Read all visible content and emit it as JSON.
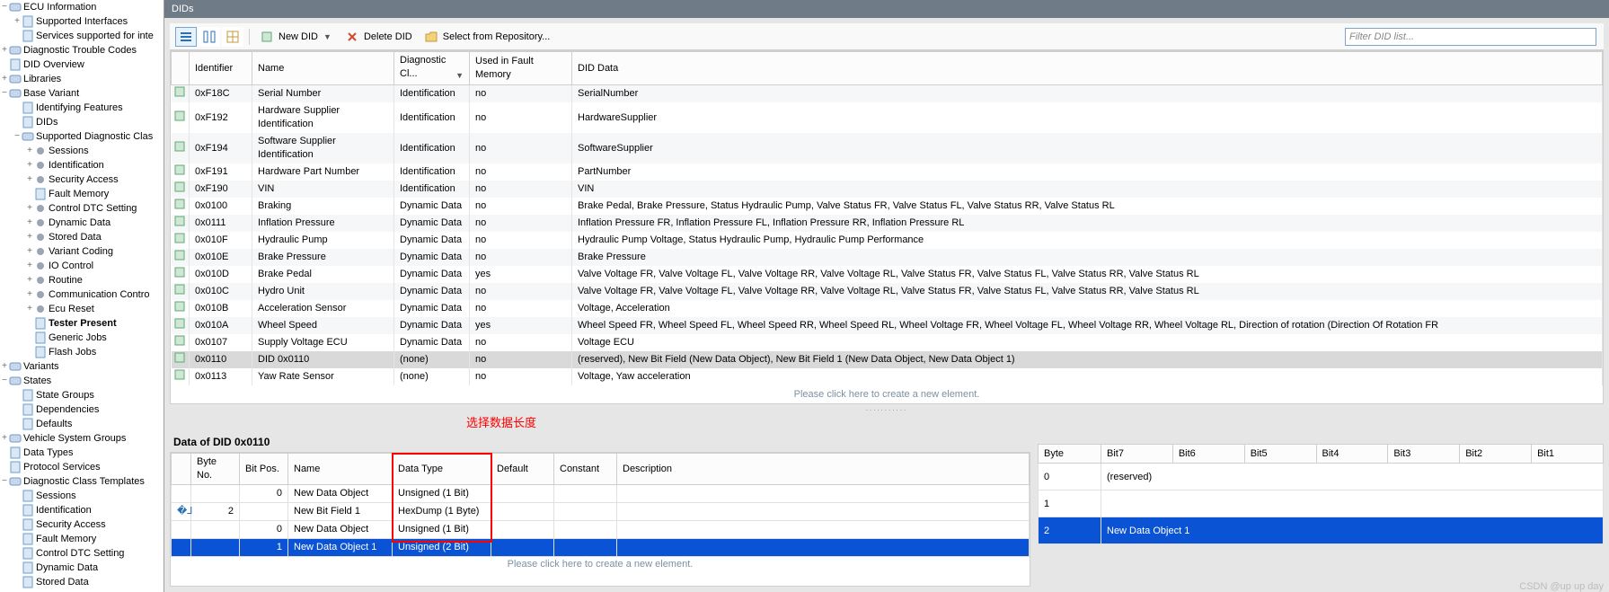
{
  "title_strip": "DIDs",
  "toolbar": {
    "new_did": "New DID",
    "delete_did": "Delete DID",
    "select_repo": "Select from Repository...",
    "filter_placeholder": "Filter DID list..."
  },
  "red_annotation": "选择数据长度",
  "tree": [
    {
      "ind": 0,
      "tw": "−",
      "ico": "db",
      "label": "ECU Information"
    },
    {
      "ind": 1,
      "tw": "+",
      "ico": "doc",
      "label": "Supported Interfaces"
    },
    {
      "ind": 1,
      "tw": "",
      "ico": "doc",
      "label": "Services supported for inte"
    },
    {
      "ind": 0,
      "tw": "+",
      "ico": "db",
      "label": "Diagnostic Trouble Codes"
    },
    {
      "ind": 0,
      "tw": "",
      "ico": "doc",
      "label": "DID Overview"
    },
    {
      "ind": 0,
      "tw": "+",
      "ico": "db",
      "label": "Libraries"
    },
    {
      "ind": 0,
      "tw": "−",
      "ico": "db",
      "label": "Base Variant"
    },
    {
      "ind": 1,
      "tw": "",
      "ico": "doc",
      "label": "Identifying Features"
    },
    {
      "ind": 1,
      "tw": "",
      "ico": "doc",
      "label": "DIDs"
    },
    {
      "ind": 1,
      "tw": "−",
      "ico": "db",
      "label": "Supported Diagnostic Clas"
    },
    {
      "ind": 2,
      "tw": "+",
      "ico": "gear",
      "label": "Sessions"
    },
    {
      "ind": 2,
      "tw": "+",
      "ico": "gear",
      "label": "Identification"
    },
    {
      "ind": 2,
      "tw": "+",
      "ico": "gear",
      "label": "Security Access"
    },
    {
      "ind": 2,
      "tw": "",
      "ico": "doc",
      "label": "Fault Memory"
    },
    {
      "ind": 2,
      "tw": "+",
      "ico": "gear",
      "label": "Control DTC Setting"
    },
    {
      "ind": 2,
      "tw": "+",
      "ico": "gear",
      "label": "Dynamic Data"
    },
    {
      "ind": 2,
      "tw": "+",
      "ico": "gear",
      "label": "Stored Data"
    },
    {
      "ind": 2,
      "tw": "+",
      "ico": "gear",
      "label": "Variant Coding"
    },
    {
      "ind": 2,
      "tw": "+",
      "ico": "gear",
      "label": "IO Control"
    },
    {
      "ind": 2,
      "tw": "+",
      "ico": "gear",
      "label": "Routine"
    },
    {
      "ind": 2,
      "tw": "+",
      "ico": "gear",
      "label": "Communication Contro"
    },
    {
      "ind": 2,
      "tw": "+",
      "ico": "gear",
      "label": "Ecu Reset"
    },
    {
      "ind": 2,
      "tw": "",
      "ico": "doc",
      "label": "Tester Present",
      "bold": true
    },
    {
      "ind": 2,
      "tw": "",
      "ico": "doc",
      "label": "Generic Jobs"
    },
    {
      "ind": 2,
      "tw": "",
      "ico": "doc",
      "label": "Flash Jobs"
    },
    {
      "ind": 0,
      "tw": "+",
      "ico": "db",
      "label": "Variants"
    },
    {
      "ind": 0,
      "tw": "−",
      "ico": "db",
      "label": "States"
    },
    {
      "ind": 1,
      "tw": "",
      "ico": "doc",
      "label": "State Groups"
    },
    {
      "ind": 1,
      "tw": "",
      "ico": "doc",
      "label": "Dependencies"
    },
    {
      "ind": 1,
      "tw": "",
      "ico": "doc",
      "label": "Defaults"
    },
    {
      "ind": 0,
      "tw": "+",
      "ico": "db",
      "label": "Vehicle System Groups"
    },
    {
      "ind": 0,
      "tw": "",
      "ico": "doc",
      "label": "Data Types"
    },
    {
      "ind": 0,
      "tw": "",
      "ico": "doc",
      "label": "Protocol Services"
    },
    {
      "ind": 0,
      "tw": "−",
      "ico": "db",
      "label": "Diagnostic Class Templates"
    },
    {
      "ind": 1,
      "tw": "",
      "ico": "doc",
      "label": "Sessions"
    },
    {
      "ind": 1,
      "tw": "",
      "ico": "doc",
      "label": "Identification"
    },
    {
      "ind": 1,
      "tw": "",
      "ico": "doc",
      "label": "Security Access"
    },
    {
      "ind": 1,
      "tw": "",
      "ico": "doc",
      "label": "Fault Memory"
    },
    {
      "ind": 1,
      "tw": "",
      "ico": "doc",
      "label": "Control DTC Setting"
    },
    {
      "ind": 1,
      "tw": "",
      "ico": "doc",
      "label": "Dynamic Data"
    },
    {
      "ind": 1,
      "tw": "",
      "ico": "doc",
      "label": "Stored Data"
    }
  ],
  "grid": {
    "headers": {
      "identifier": "Identifier",
      "name": "Name",
      "diag": "Diagnostic Cl...",
      "fault": "Used in Fault Memory",
      "data": "DID Data"
    },
    "rows": [
      {
        "id": "0xF18C",
        "name": "Serial Number",
        "diag": "Identification",
        "fault": "no",
        "data": "SerialNumber"
      },
      {
        "id": "0xF192",
        "name": "Hardware Supplier Identification",
        "diag": "Identification",
        "fault": "no",
        "data": "HardwareSupplier"
      },
      {
        "id": "0xF194",
        "name": "Software Supplier Identification",
        "diag": "Identification",
        "fault": "no",
        "data": "SoftwareSupplier"
      },
      {
        "id": "0xF191",
        "name": "Hardware Part Number",
        "diag": "Identification",
        "fault": "no",
        "data": "PartNumber"
      },
      {
        "id": "0xF190",
        "name": "VIN",
        "diag": "Identification",
        "fault": "no",
        "data": "VIN"
      },
      {
        "id": "0x0100",
        "name": "Braking",
        "diag": "Dynamic Data",
        "fault": "no",
        "data": "Brake Pedal, Brake Pressure, Status Hydraulic Pump, Valve Status FR, Valve Status FL, Valve Status RR, Valve Status RL"
      },
      {
        "id": "0x0111",
        "name": "Inflation Pressure",
        "diag": "Dynamic Data",
        "fault": "no",
        "data": "Inflation Pressure FR, Inflation Pressure FL, Inflation Pressure RR, Inflation Pressure RL"
      },
      {
        "id": "0x010F",
        "name": "Hydraulic Pump",
        "diag": "Dynamic Data",
        "fault": "no",
        "data": "Hydraulic Pump Voltage, Status Hydraulic Pump, Hydraulic Pump Performance"
      },
      {
        "id": "0x010E",
        "name": "Brake Pressure",
        "diag": "Dynamic Data",
        "fault": "no",
        "data": "Brake Pressure"
      },
      {
        "id": "0x010D",
        "name": "Brake Pedal",
        "diag": "Dynamic Data",
        "fault": "yes",
        "data": "Valve Voltage FR, Valve Voltage FL, Valve Voltage RR, Valve Voltage RL, Valve Status FR, Valve Status FL, Valve Status RR, Valve Status RL"
      },
      {
        "id": "0x010C",
        "name": "Hydro Unit",
        "diag": "Dynamic Data",
        "fault": "no",
        "data": "Valve Voltage FR, Valve Voltage FL, Valve Voltage RR, Valve Voltage RL, Valve Status FR, Valve Status FL, Valve Status RR, Valve Status RL"
      },
      {
        "id": "0x010B",
        "name": "Acceleration Sensor",
        "diag": "Dynamic Data",
        "fault": "no",
        "data": "Voltage, Acceleration"
      },
      {
        "id": "0x010A",
        "name": "Wheel Speed",
        "diag": "Dynamic Data",
        "fault": "yes",
        "data": "Wheel Speed FR, Wheel Speed FL, Wheel Speed RR, Wheel Speed RL, Wheel Voltage FR, Wheel Voltage FL, Wheel Voltage RR, Wheel Voltage RL, Direction of rotation (Direction Of Rotation FR"
      },
      {
        "id": "0x0107",
        "name": "Supply Voltage ECU",
        "diag": "Dynamic Data",
        "fault": "no",
        "data": "Voltage ECU"
      },
      {
        "id": "0x0110",
        "name": "DID 0x0110",
        "diag": "(none)",
        "fault": "no",
        "data": "(reserved), New Bit Field (New Data Object), New Bit Field 1 (New Data Object, New Data Object 1)",
        "sel": true
      },
      {
        "id": "0x0113",
        "name": "Yaw Rate Sensor",
        "diag": "(none)",
        "fault": "no",
        "data": "Voltage, Yaw acceleration"
      }
    ],
    "footer": "Please click here to create a new element."
  },
  "data_panel": {
    "title": "Data of DID 0x0110",
    "headers": {
      "byteno": "Byte No.",
      "bitpos": "Bit Pos.",
      "name": "Name",
      "datatype": "Data Type",
      "default": "Default",
      "constant": "Constant",
      "desc": "Description"
    },
    "rows": [
      {
        "byteno": "",
        "bitpos": "0",
        "name": "New Data Object",
        "datatype": "Unsigned (1 Bit)",
        "default": "",
        "constant": "",
        "desc": ""
      },
      {
        "byteno": "2",
        "bitpos": "",
        "name": "New Bit Field 1",
        "datatype": "HexDump (1 Byte)",
        "default": "",
        "constant": "",
        "desc": "",
        "haslead": true
      },
      {
        "byteno": "",
        "bitpos": "0",
        "name": "New Data Object",
        "datatype": "Unsigned (1 Bit)",
        "default": "",
        "constant": "",
        "desc": ""
      },
      {
        "byteno": "",
        "bitpos": "1",
        "name": "New Data Object 1",
        "datatype": "Unsigned (2 Bit)",
        "default": "",
        "constant": "",
        "desc": "",
        "sel": true
      }
    ],
    "footer": "Please click here to create a new element."
  },
  "bit_panel": {
    "headers": {
      "byte": "Byte",
      "b7": "Bit7",
      "b6": "Bit6",
      "b5": "Bit5",
      "b4": "Bit4",
      "b3": "Bit3",
      "b2": "Bit2",
      "b1": "Bit1"
    },
    "rows": [
      {
        "byte": "0",
        "cell": "(reserved)"
      },
      {
        "byte": "1",
        "cell": ""
      },
      {
        "byte": "2",
        "cell": "New Data Object 1",
        "sel": true
      }
    ]
  },
  "watermark": "CSDN @up up day"
}
